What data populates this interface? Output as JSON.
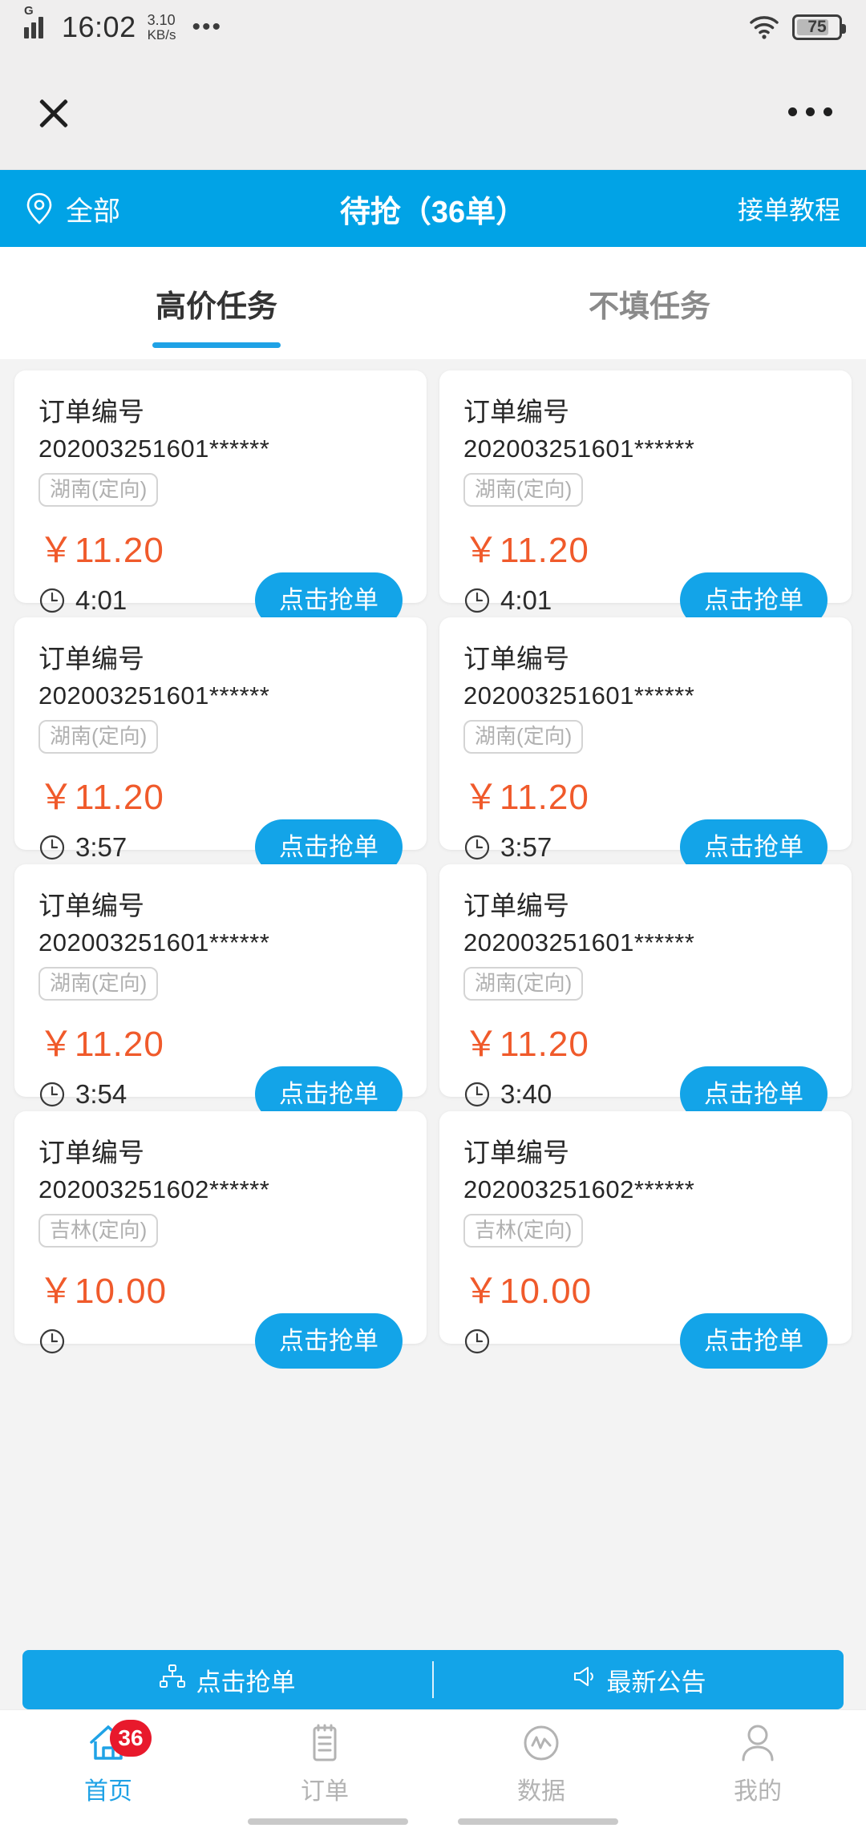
{
  "statusbar": {
    "network_type": "G",
    "time": "16:02",
    "speed_value": "3.10",
    "speed_unit": "KB/s",
    "overflow": "•••",
    "battery_level": "75",
    "wifi_icon": "wifi-icon",
    "signal_icon": "signal-bars-icon"
  },
  "webbar": {
    "close_icon": "close-icon",
    "more_icon": "more-options-icon"
  },
  "appheader": {
    "location_icon": "location-pin-icon",
    "location_label": "全部",
    "title": "待抢（36单）",
    "tutorial_label": "接单教程",
    "bg_color": "#01a3e6"
  },
  "tabs": [
    {
      "label": "高价任务",
      "active": true
    },
    {
      "label": "不填任务",
      "active": false
    }
  ],
  "order_card_labels": {
    "order_no_label": "订单编号",
    "grab_button": "点击抢单",
    "clock_icon": "clock-icon"
  },
  "orders": [
    {
      "order_no": "202003251601******",
      "region": "湖南(定向)",
      "price": "￥11.20",
      "timer": "4:01",
      "action": "点击抢单"
    },
    {
      "order_no": "202003251601******",
      "region": "湖南(定向)",
      "price": "￥11.20",
      "timer": "4:01",
      "action": "点击抢单"
    },
    {
      "order_no": "202003251601******",
      "region": "湖南(定向)",
      "price": "￥11.20",
      "timer": "3:57",
      "action": "点击抢单"
    },
    {
      "order_no": "202003251601******",
      "region": "湖南(定向)",
      "price": "￥11.20",
      "timer": "3:57",
      "action": "点击抢单"
    },
    {
      "order_no": "202003251601******",
      "region": "湖南(定向)",
      "price": "￥11.20",
      "timer": "3:54",
      "action": "点击抢单"
    },
    {
      "order_no": "202003251601******",
      "region": "湖南(定向)",
      "price": "￥11.20",
      "timer": "3:40",
      "action": "点击抢单"
    },
    {
      "order_no": "202003251602******",
      "region": "吉林(定向)",
      "price": "￥10.00",
      "timer": "",
      "action": "点击抢单"
    },
    {
      "order_no": "202003251602******",
      "region": "吉林(定向)",
      "price": "￥10.00",
      "timer": "",
      "action": "点击抢单"
    }
  ],
  "actionbar": {
    "grab_icon": "network-nodes-icon",
    "grab_label": "点击抢单",
    "notice_icon": "megaphone-icon",
    "notice_label": "最新公告",
    "bg_color": "#13a4e8"
  },
  "bottomnav": [
    {
      "label": "首页",
      "icon": "home-icon",
      "active": true,
      "badge": "36"
    },
    {
      "label": "订单",
      "icon": "clipboard-icon",
      "active": false,
      "badge": ""
    },
    {
      "label": "数据",
      "icon": "chart-circle-icon",
      "active": false,
      "badge": ""
    },
    {
      "label": "我的",
      "icon": "person-icon",
      "active": false,
      "badge": ""
    }
  ],
  "colors": {
    "accent": "#13a4e8",
    "header": "#01a3e6",
    "price": "#f05a2b",
    "badge": "#e8192c"
  }
}
